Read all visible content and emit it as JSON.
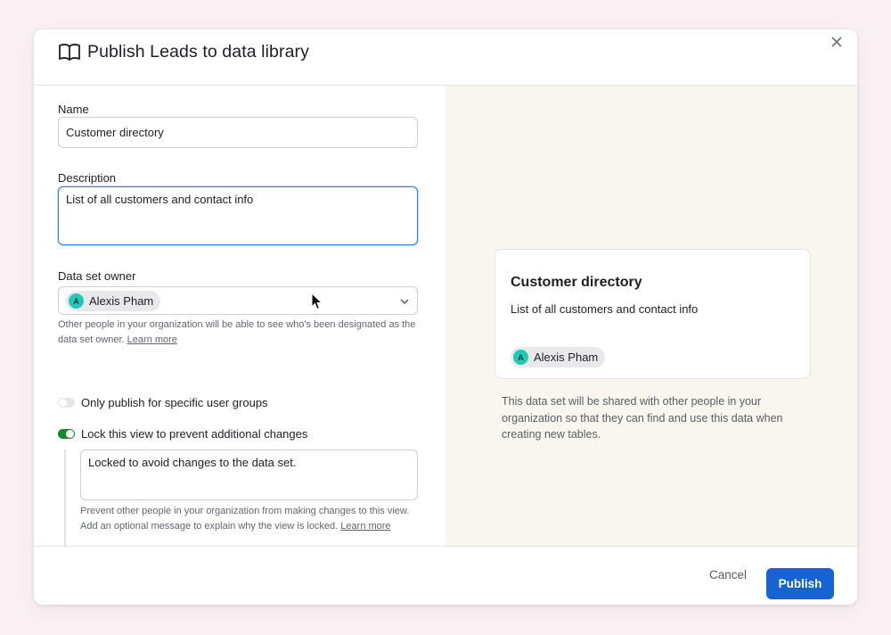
{
  "dialog": {
    "title": "Publish Leads to data library"
  },
  "form": {
    "name_label": "Name",
    "name_value": "Customer directory",
    "description_label": "Description",
    "description_value": "List of all customers and contact info",
    "owner_label": "Data set owner",
    "owner_initial": "A",
    "owner_name": "Alexis Pham",
    "owner_help": "Other people in your organization will be able to see who's been designated as the data set owner.",
    "owner_help_link": "Learn more",
    "toggle_groups_label": "Only publish for specific user groups",
    "toggle_groups_on": false,
    "toggle_lock_label": "Lock this view to prevent additional changes",
    "toggle_lock_on": true,
    "lock_message_value": "Locked to avoid changes to the data set.",
    "lock_help": "Prevent other people in your organization from making changes to this view. Add an optional message to explain why the view is locked.",
    "lock_help_link": "Learn more"
  },
  "preview": {
    "title": "Customer directory",
    "description": "List of all customers and contact info",
    "owner_initial": "A",
    "owner_name": "Alexis Pham",
    "share_note": "This data set will be shared with other people in your organization so that they can find and use this data when creating new tables."
  },
  "footer": {
    "cancel_label": "Cancel",
    "publish_label": "Publish"
  },
  "colors": {
    "accent": "#1663d6",
    "toggle_on": "#138a2b",
    "avatar": "#20c9b8",
    "preview_bg": "#f9f6ef",
    "page_bg": "#fbf1f4"
  },
  "icons": [
    "book-icon",
    "close-icon",
    "chevron-down-icon",
    "mouse-cursor-icon"
  ]
}
